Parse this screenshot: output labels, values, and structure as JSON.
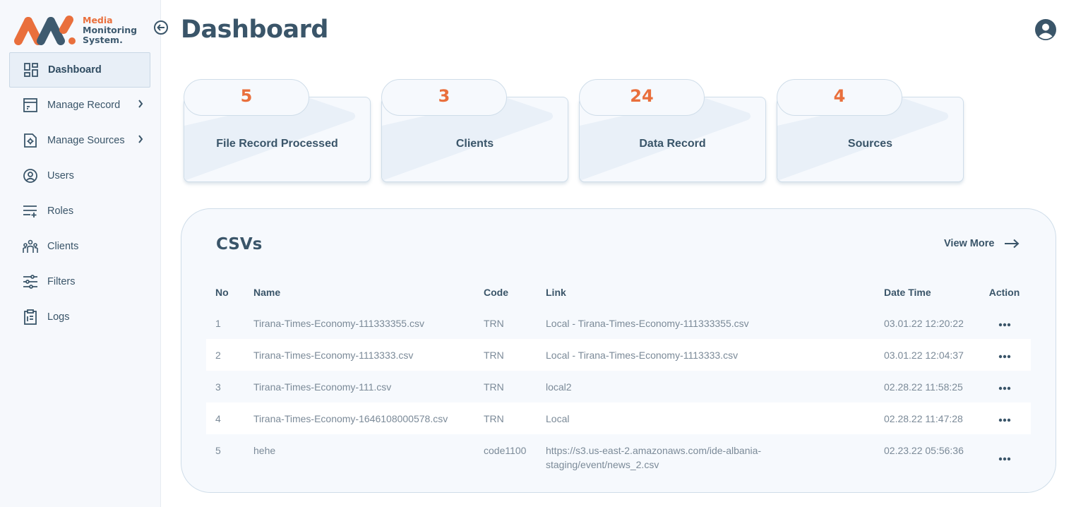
{
  "logo": {
    "line1": "Media",
    "line2": "Monitoring",
    "line3": "System."
  },
  "sidebar": {
    "items": [
      {
        "label": "Dashboard",
        "icon": "dashboard-icon"
      },
      {
        "label": "Manage Record",
        "icon": "record-icon"
      },
      {
        "label": "Manage Sources",
        "icon": "sources-icon"
      },
      {
        "label": "Users",
        "icon": "user-icon"
      },
      {
        "label": "Roles",
        "icon": "roles-icon"
      },
      {
        "label": "Clients",
        "icon": "clients-icon"
      },
      {
        "label": "Filters",
        "icon": "filters-icon"
      },
      {
        "label": "Logs",
        "icon": "logs-icon"
      }
    ]
  },
  "header": {
    "title": "Dashboard"
  },
  "stats": [
    {
      "value": "5",
      "label": "File Record Processed"
    },
    {
      "value": "3",
      "label": "Clients"
    },
    {
      "value": "24",
      "label": "Data Record"
    },
    {
      "value": "4",
      "label": "Sources"
    }
  ],
  "csvs": {
    "title": "CSVs",
    "view_more": "View More",
    "columns": [
      "No",
      "Name",
      "Code",
      "Link",
      "Date Time",
      "Action"
    ],
    "rows": [
      {
        "no": "1",
        "name": "Tirana-Times-Economy-111333355.csv",
        "code": "TRN",
        "link": "Local - Tirana-Times-Economy-111333355.csv",
        "datetime": "03.01.22 12:20:22"
      },
      {
        "no": "2",
        "name": "Tirana-Times-Economy-1113333.csv",
        "code": "TRN",
        "link": "Local - Tirana-Times-Economy-1113333.csv",
        "datetime": "03.01.22 12:04:37"
      },
      {
        "no": "3",
        "name": "Tirana-Times-Economy-111.csv",
        "code": "TRN",
        "link": "local2",
        "datetime": "02.28.22 11:58:25"
      },
      {
        "no": "4",
        "name": "Tirana-Times-Economy-1646108000578.csv",
        "code": "TRN",
        "link": "Local",
        "datetime": "02.28.22 11:47:28"
      },
      {
        "no": "5",
        "name": "hehe",
        "code": "code1100",
        "link": "https://s3.us-east-2.amazonaws.com/ide-albania-staging/event/news_2.csv",
        "link_line1": "https://s3.us-east-2.amazonaws.com/ide-albania-",
        "link_line2": "staging/event/news_2.csv",
        "datetime": "02.23.22 05:56:36"
      }
    ]
  },
  "colors": {
    "accent": "#e96f3c",
    "primary": "#3a5569",
    "muted": "#7b8a98"
  }
}
